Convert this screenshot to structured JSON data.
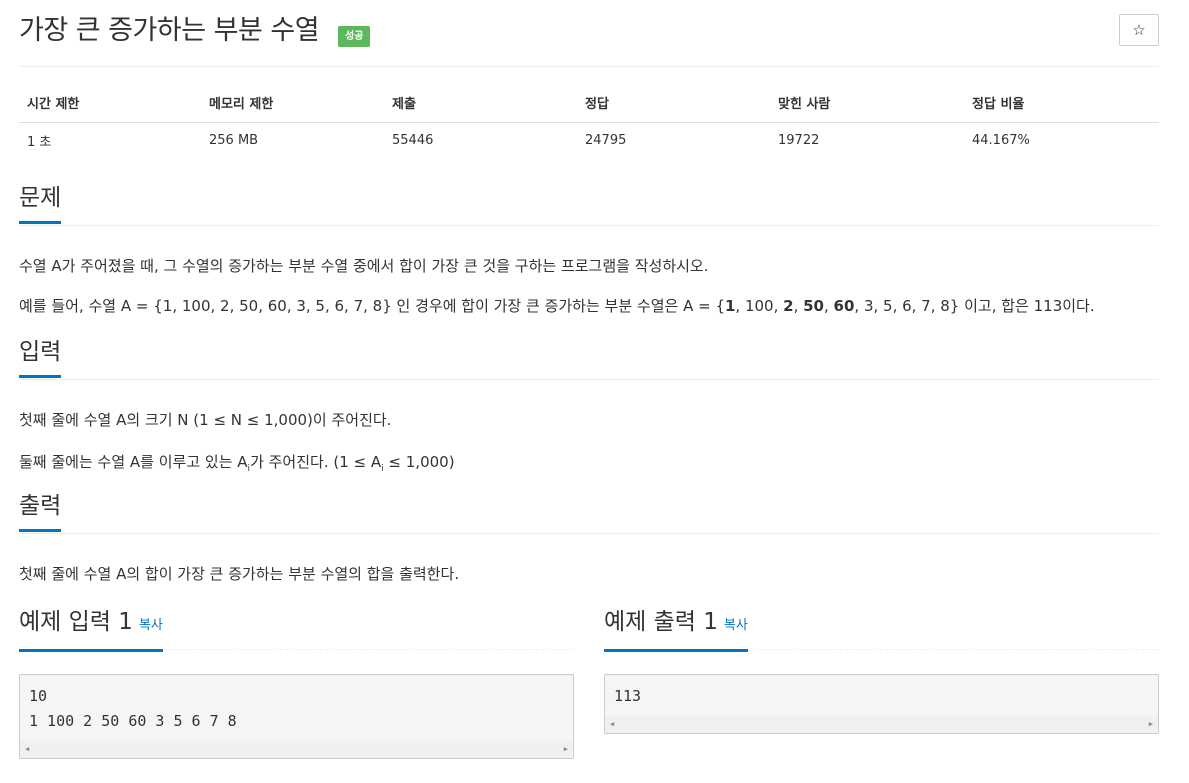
{
  "header": {
    "title": "가장 큰 증가하는 부분 수열",
    "badge": "성공",
    "star_icon": "☆"
  },
  "info": {
    "headers": [
      "시간 제한",
      "메모리 제한",
      "제출",
      "정답",
      "맞힌 사람",
      "정답 비율"
    ],
    "values": [
      "1 초",
      "256 MB",
      "55446",
      "24795",
      "19722",
      "44.167%"
    ]
  },
  "problem": {
    "title": "문제",
    "p1": "수열 A가 주어졌을 때, 그 수열의 증가하는 부분 수열 중에서 합이 가장 큰 것을 구하는 프로그램을 작성하시오.",
    "p2_pre": "예를 들어, 수열 A = {1, 100, 2, 50, 60, 3, 5, 6, 7, 8} 인 경우에 합이 가장 큰 증가하는 부분 수열은 A = {",
    "p2_b1": "1",
    "p2_m1": ", 100, ",
    "p2_b2": "2",
    "p2_m2": ", ",
    "p2_b3": "50",
    "p2_m3": ", ",
    "p2_b4": "60",
    "p2_post": ", 3, 5, 6, 7, 8} 이고, 합은 113이다."
  },
  "input": {
    "title": "입력",
    "p1": "첫째 줄에 수열 A의 크기 N (1 ≤ N ≤ 1,000)이 주어진다.",
    "p2_a": "둘째 줄에는 수열 A를 이루고 있는 A",
    "p2_sub1": "i",
    "p2_b": "가 주어진다. (1 ≤ A",
    "p2_sub2": "i",
    "p2_c": " ≤ 1,000)"
  },
  "output": {
    "title": "출력",
    "p1": "첫째 줄에 수열 A의 합이 가장 큰 증가하는 부분 수열의 합을 출력한다."
  },
  "samples": {
    "input_title": "예제 입력 1",
    "output_title": "예제 출력 1",
    "copy_label": "복사",
    "input_lines": [
      "10",
      "1 100 2 50 60 3 5 6 7 8"
    ],
    "output_lines": [
      "113"
    ]
  }
}
